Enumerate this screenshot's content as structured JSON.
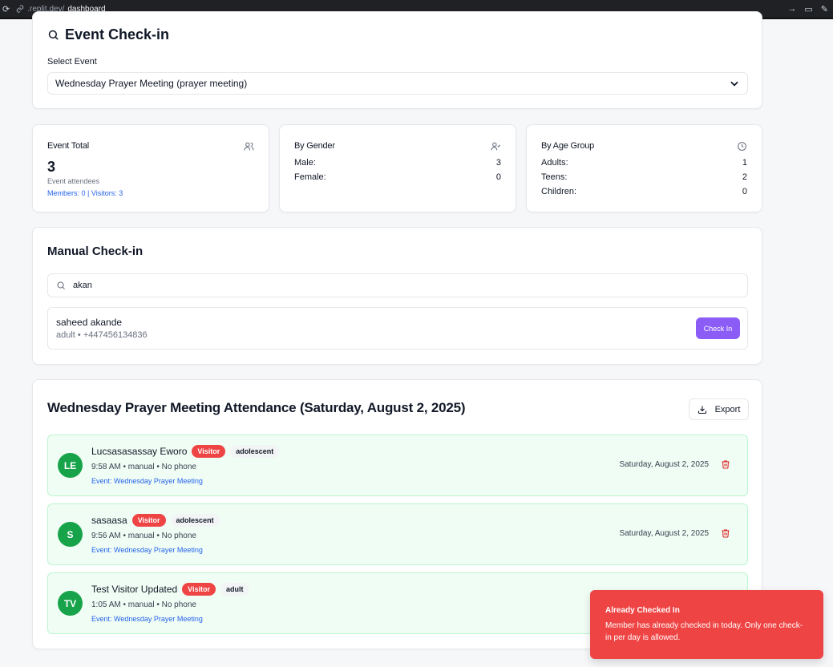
{
  "browser": {
    "address_host": ".replit.dev/",
    "address_path": "dashboard"
  },
  "event_checkin": {
    "title": "Event Check-in",
    "select_label": "Select Event",
    "selected_event": "Wednesday Prayer Meeting (prayer meeting)"
  },
  "stats": {
    "event_total": {
      "title": "Event Total",
      "value": "3",
      "subtitle": "Event attendees",
      "breakdown": "Members: 0 | Visitors: 3"
    },
    "by_gender": {
      "title": "By Gender",
      "rows": [
        {
          "label": "Male:",
          "value": "3"
        },
        {
          "label": "Female:",
          "value": "0"
        }
      ]
    },
    "by_age_group": {
      "title": "By Age Group",
      "rows": [
        {
          "label": "Adults:",
          "value": "1"
        },
        {
          "label": "Teens:",
          "value": "2"
        },
        {
          "label": "Children:",
          "value": "0"
        }
      ]
    }
  },
  "manual_checkin": {
    "title": "Manual Check-in",
    "search_value": "akan",
    "result": {
      "name": "saheed akande",
      "meta": "adult • +447456134836",
      "button_label": "Check In"
    }
  },
  "attendance": {
    "title": "Wednesday Prayer Meeting Attendance (Saturday, August 2, 2025)",
    "export_label": "Export",
    "rows": [
      {
        "initials": "LE",
        "name": "Lucsasasassay Eworo",
        "badge": "Visitor",
        "age_group": "adolescent",
        "details": "9:58 AM • manual • No phone",
        "event": "Event: Wednesday Prayer Meeting",
        "date": "Saturday, August 2, 2025"
      },
      {
        "initials": "S",
        "name": "sasaasa",
        "badge": "Visitor",
        "age_group": "adolescent",
        "details": "9:56 AM • manual • No phone",
        "event": "Event: Wednesday Prayer Meeting",
        "date": "Saturday, August 2, 2025"
      },
      {
        "initials": "TV",
        "name": "Test Visitor Updated",
        "badge": "Visitor",
        "age_group": "adult",
        "details": "1:05 AM • manual • No phone",
        "event": "Event: Wednesday Prayer Meeting",
        "date": ""
      }
    ]
  },
  "toast": {
    "title": "Already Checked In",
    "message": "Member has already checked in today. Only one check-in per day is allowed."
  },
  "colors": {
    "accent_purple": "#8b5cf6",
    "visitor_red": "#ef4444",
    "avatar_green": "#16a34a",
    "row_green_bg": "#f0fdf4",
    "link_blue": "#2563eb"
  }
}
